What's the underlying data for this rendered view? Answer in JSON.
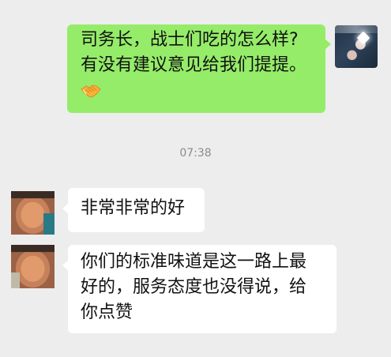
{
  "conversation": {
    "outgoing": {
      "lines": [
        "司务长，战士们吃的怎么样?",
        "有没有建议意见给我们提提。"
      ],
      "emoji": "handshake-emoji"
    },
    "timestamp": "07:38",
    "incoming": [
      {
        "lines": [
          "非常非常的好"
        ]
      },
      {
        "lines": [
          "你们的标准味道是这一路上最",
          "好的，服务态度也没得说，给",
          "你点赞"
        ]
      }
    ]
  },
  "colors": {
    "background": "#ededed",
    "outgoing_bubble": "#95ec69",
    "incoming_bubble": "#ffffff",
    "timestamp_text": "#8c8c8c"
  }
}
